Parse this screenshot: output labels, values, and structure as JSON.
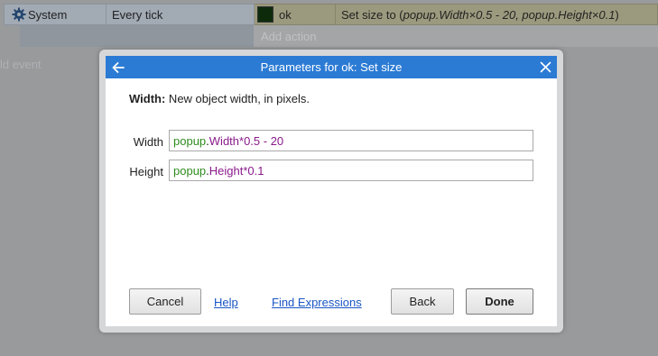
{
  "event_row": {
    "condition_object": "System",
    "condition_text": "Every tick",
    "action_object": "ok",
    "action_prefix": "Set size to (",
    "action_args": "popup.Width×0.5 - 20, popup.Height×0.1",
    "action_suffix": ")"
  },
  "add_action_label": "Add action",
  "add_event_label": "ld event",
  "dialog": {
    "title": "Parameters for ok: Set size",
    "description_bold": "Width:",
    "description_text": " New object width, in pixels.",
    "params": [
      {
        "label": "Width",
        "tokens": [
          {
            "text": "popup",
            "kind": "obj"
          },
          {
            "text": ".",
            "kind": "plain"
          },
          {
            "text": "Width",
            "kind": "exp"
          },
          {
            "text": "*0.5 - 20",
            "kind": "num"
          }
        ]
      },
      {
        "label": "Height",
        "tokens": [
          {
            "text": "popup",
            "kind": "obj"
          },
          {
            "text": ".",
            "kind": "plain"
          },
          {
            "text": "Height",
            "kind": "exp"
          },
          {
            "text": "*0.1",
            "kind": "num"
          }
        ]
      }
    ],
    "buttons": {
      "cancel": "Cancel",
      "help": "Help",
      "find_expressions": "Find Expressions",
      "back": "Back",
      "done": "Done"
    }
  },
  "colors": {
    "titlebar": "#2b7bd4",
    "object_token": "#2e8b1e",
    "expression_token": "#8a1a8a",
    "link": "#1a56c4",
    "action_swatch": "#0d2b0b"
  },
  "icons": {
    "condition_object": "gear-icon",
    "dialog_back": "arrow-left-icon",
    "dialog_close": "close-icon"
  }
}
